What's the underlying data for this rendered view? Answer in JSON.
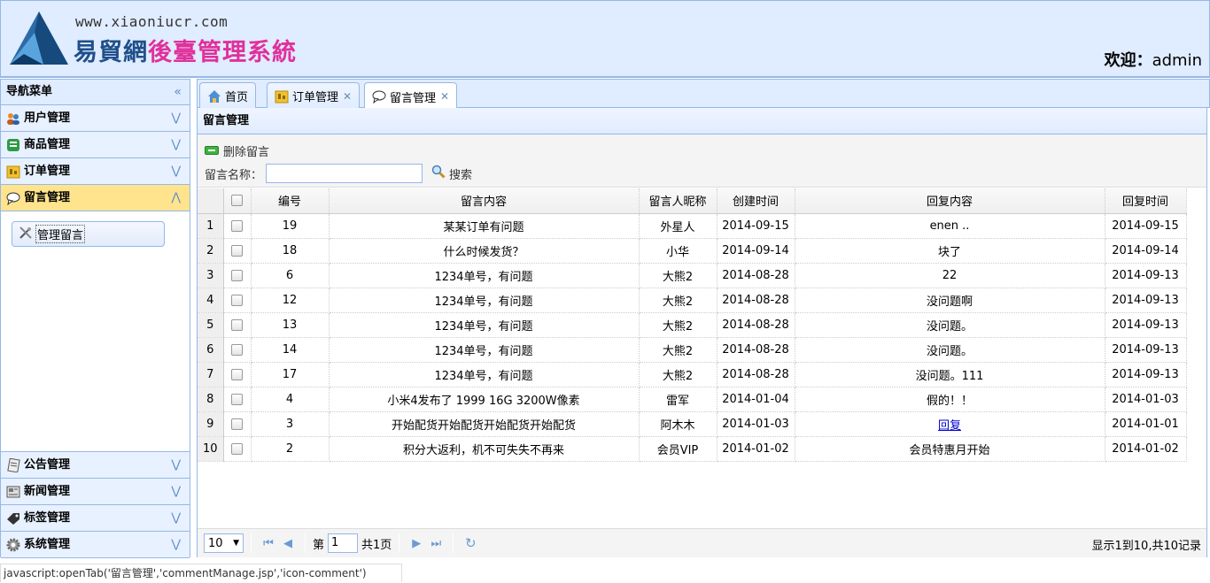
{
  "header": {
    "site_url": "www.xiaoniucr.com",
    "title_part1": "易貿網",
    "title_part2": "後臺管理系統",
    "welcome_label": "欢迎：",
    "username": "admin"
  },
  "sidebar": {
    "title": "导航菜单",
    "collapse_glyph": "«",
    "groups_top": [
      {
        "label": "用户管理",
        "icon": "users-icon"
      },
      {
        "label": "商品管理",
        "icon": "goods-icon"
      },
      {
        "label": "订单管理",
        "icon": "order-icon"
      },
      {
        "label": "留言管理",
        "icon": "comment-icon",
        "active": true
      }
    ],
    "active_items": [
      {
        "label": "管理留言",
        "icon": "tools-icon"
      }
    ],
    "groups_bottom": [
      {
        "label": "公告管理",
        "icon": "notice-icon"
      },
      {
        "label": "新闻管理",
        "icon": "news-icon"
      },
      {
        "label": "标签管理",
        "icon": "tag-icon"
      },
      {
        "label": "系统管理",
        "icon": "gear-icon"
      }
    ]
  },
  "tabs": [
    {
      "label": "首页",
      "icon": "home-icon",
      "closable": false
    },
    {
      "label": "订单管理",
      "icon": "order-icon",
      "closable": true
    },
    {
      "label": "留言管理",
      "icon": "comment-icon",
      "closable": true,
      "selected": true
    }
  ],
  "panel": {
    "title": "留言管理",
    "delete_label": "删除留言",
    "search_label": "留言名称：",
    "search_value": "",
    "search_button": "搜索"
  },
  "grid": {
    "columns": [
      "编号",
      "留言内容",
      "留言人昵称",
      "创建时间",
      "回复内容",
      "回复时间"
    ],
    "rows": [
      {
        "rn": "1",
        "id": "19",
        "content": "某某订单有问题",
        "nick": "外星人",
        "created": "2014-09-15",
        "reply": "enen ..",
        "reply_time": "2014-09-15"
      },
      {
        "rn": "2",
        "id": "18",
        "content": "什么时候发货？",
        "nick": "小华",
        "created": "2014-09-14",
        "reply": "块了",
        "reply_time": "2014-09-14"
      },
      {
        "rn": "3",
        "id": "6",
        "content": "1234单号，有问题",
        "nick": "大熊2",
        "created": "2014-08-28",
        "reply": "22",
        "reply_time": "2014-09-13"
      },
      {
        "rn": "4",
        "id": "12",
        "content": "1234单号，有问题",
        "nick": "大熊2",
        "created": "2014-08-28",
        "reply": "没问题啊",
        "reply_time": "2014-09-13"
      },
      {
        "rn": "5",
        "id": "13",
        "content": "1234单号，有问题",
        "nick": "大熊2",
        "created": "2014-08-28",
        "reply": "没问题。",
        "reply_time": "2014-09-13"
      },
      {
        "rn": "6",
        "id": "14",
        "content": "1234单号，有问题",
        "nick": "大熊2",
        "created": "2014-08-28",
        "reply": "没问题。",
        "reply_time": "2014-09-13"
      },
      {
        "rn": "7",
        "id": "17",
        "content": "1234单号，有问题",
        "nick": "大熊2",
        "created": "2014-08-28",
        "reply": "没问题。111",
        "reply_time": "2014-09-13"
      },
      {
        "rn": "8",
        "id": "4",
        "content": "小米4发布了 1999 16G 3200W像素",
        "nick": "雷军",
        "created": "2014-01-04",
        "reply": "假的！！",
        "reply_time": "2014-01-03"
      },
      {
        "rn": "9",
        "id": "3",
        "content": "开始配货开始配货开始配货开始配货",
        "nick": "阿木木",
        "created": "2014-01-03",
        "reply": "回复",
        "reply_link": true,
        "reply_time": "2014-01-01"
      },
      {
        "rn": "10",
        "id": "2",
        "content": "积分大返利，机不可失失不再来",
        "nick": "会员VIP",
        "created": "2014-01-02",
        "reply": "会员特惠月开始",
        "reply_time": "2014-01-02"
      }
    ]
  },
  "pager": {
    "page_size": "10",
    "page_prefix": "第",
    "page_value": "1",
    "page_total": "共1页",
    "info": "显示1到10,共10记录"
  },
  "statusbar": {
    "text": "javascript:openTab('留言管理','commentManage.jsp','icon-comment')"
  },
  "colors": {
    "border": "#95b8e7",
    "header_bg": "#e0ecff",
    "active_group_bg": "#ffe48d",
    "title_pink": "#e0309b",
    "title_blue": "#1f4f8a"
  }
}
